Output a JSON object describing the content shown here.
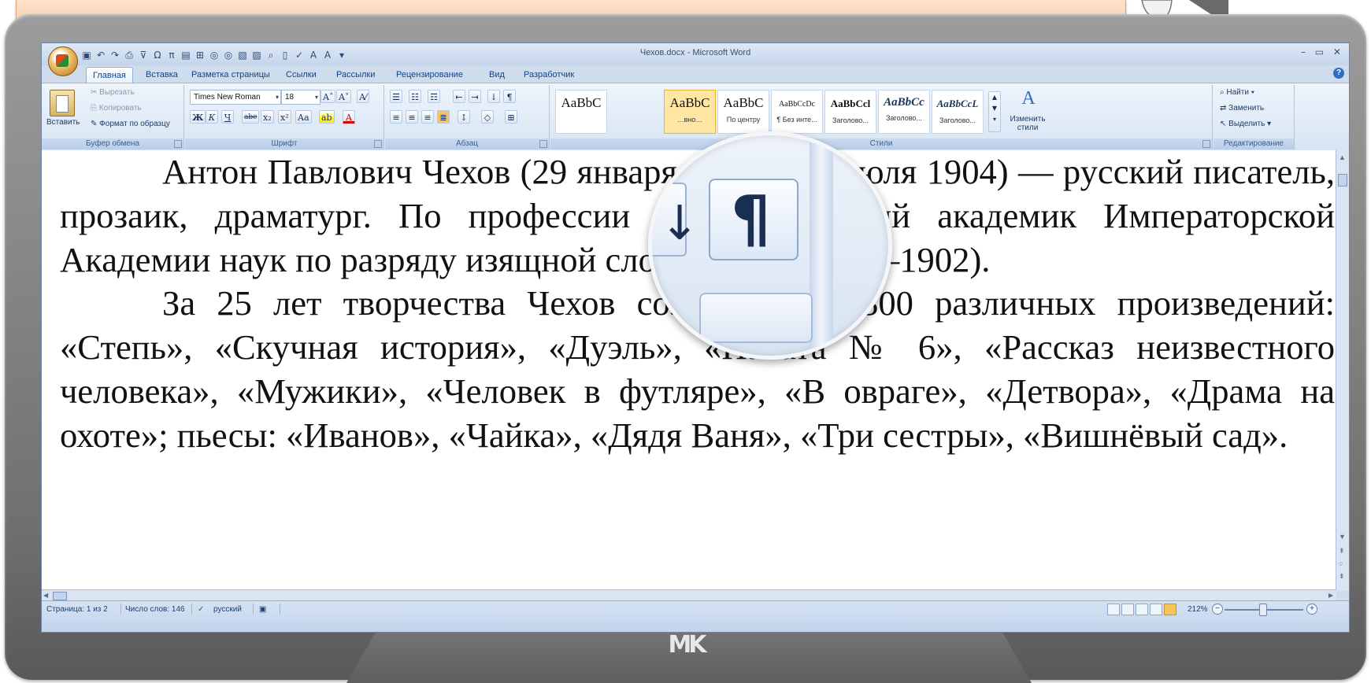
{
  "window": {
    "title": "Чехов.docx - Microsoft Word",
    "controls": "– ▭ ✕"
  },
  "tabs": [
    "Главная",
    "Вставка",
    "Разметка страницы",
    "Ссылки",
    "Рассылки",
    "Рецензирование",
    "Вид",
    "Разработчик"
  ],
  "active_tab": "Главная",
  "clipboard": {
    "paste": "Вставить",
    "cut": "Вырезать",
    "copy": "Копировать",
    "format_painter": "Формат по образцу",
    "label": "Буфер обмена"
  },
  "font": {
    "name": "Times New Roman",
    "size": "18",
    "label": "Шрифт",
    "bold": "Ж",
    "italic": "К",
    "underline": "Ч",
    "strike": "abe",
    "subscript": "x₂",
    "superscript": "x²",
    "case": "Aa",
    "grow": "A˄",
    "shrink": "A˅",
    "clear": "A⁄",
    "highlight": "ab",
    "color": "A"
  },
  "paragraph": {
    "label": "Абзац",
    "show_marks": "¶"
  },
  "styles": {
    "label": "Стили",
    "tiles": [
      {
        "preview": "AaBbC",
        "name": ""
      },
      {
        "preview": "AaBbC",
        "name": "…вно…"
      },
      {
        "preview": "AaBbC",
        "name": "По центру"
      },
      {
        "preview": "AaBbCcDc",
        "name": "¶ Без инте..."
      },
      {
        "preview": "AaBbCcl",
        "name": "Заголово..."
      },
      {
        "preview": "AaBbCc",
        "name": "Заголово..."
      },
      {
        "preview": "AaBbCcL",
        "name": "Заголово..."
      }
    ],
    "change_styles": "Изменить стили"
  },
  "editing": {
    "find": "Найти",
    "replace": "Заменить",
    "select": "Выделить",
    "label": "Редактирование"
  },
  "document": {
    "paragraphs": [
      "Антон Павлович  Чехов (29 января 1860 –  15 июля 1904) — русский  писатель,  прозаик,  драматург.  По  профессии  врач. Почётный  академик  Императорской  Академии  наук  по  разряду изящной словесности (1900–1902).",
      "За  25 лет  творчества  Чехов  создал  более  300 различных произведений:  «Степь»,  «Скучная  история»,  «Дуэль»,  «Палата № 6»,  «Рассказ  неизвестного  человека»,  «Мужики»,  «Человек  в футляре»,  «В овраге»,  «Детвора»,  «Драма  на  охоте»;  пьесы: «Иванов», «Чайка», «Дядя Ваня», «Три сестры», «Вишнёвый сад»."
    ]
  },
  "status": {
    "page": "Страница: 1 из 2",
    "words": "Число слов: 146",
    "language": "русский",
    "zoom": "212%"
  },
  "magnifier": {
    "symbol": "¶",
    "arrow": "↓"
  },
  "brand": "MK"
}
